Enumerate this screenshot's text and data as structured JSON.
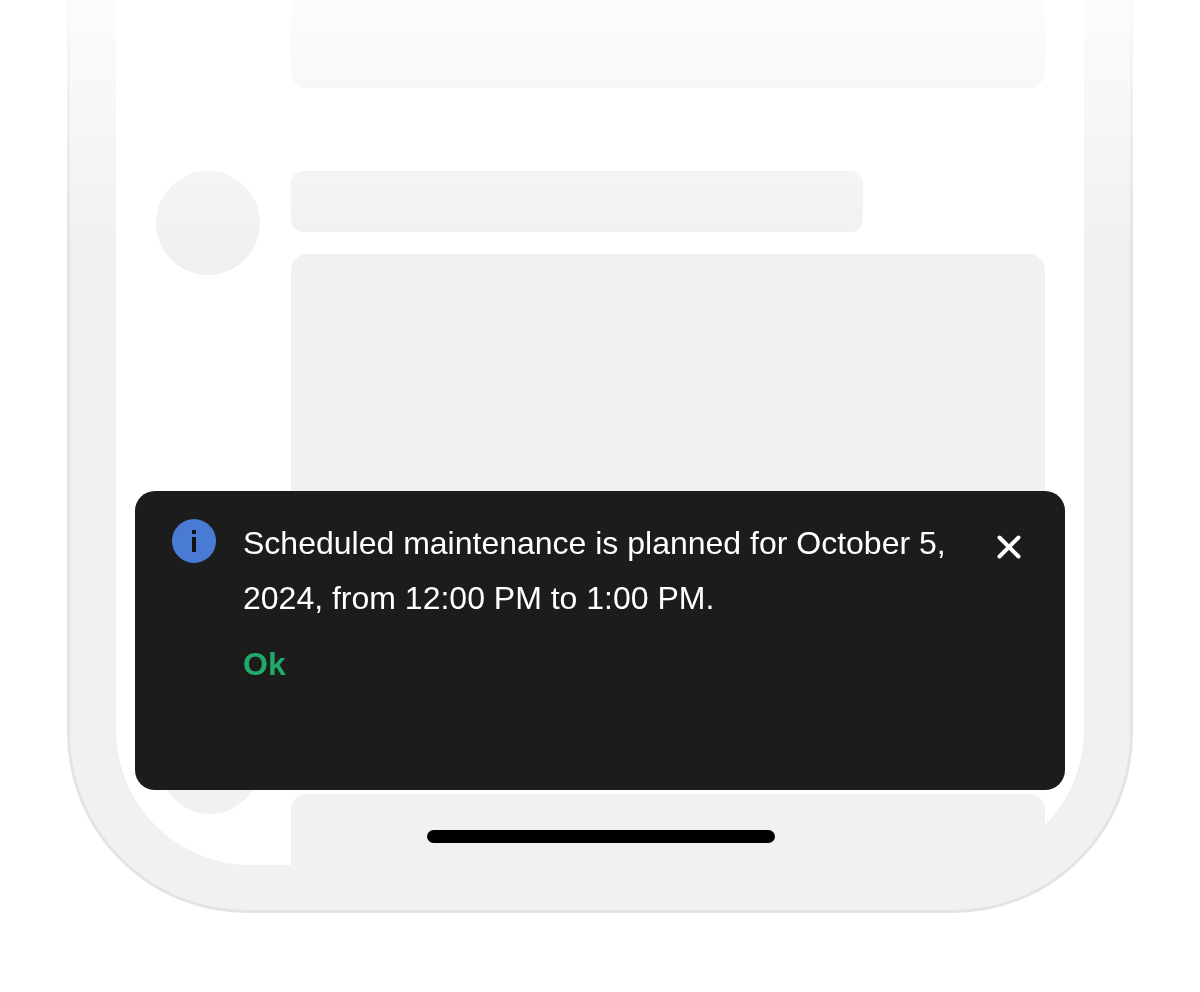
{
  "toast": {
    "kind": "info",
    "message": "Scheduled maintenance is planned for October 5, 2024, from 12:00 PM to 1:00 PM.",
    "action": "Ok"
  }
}
